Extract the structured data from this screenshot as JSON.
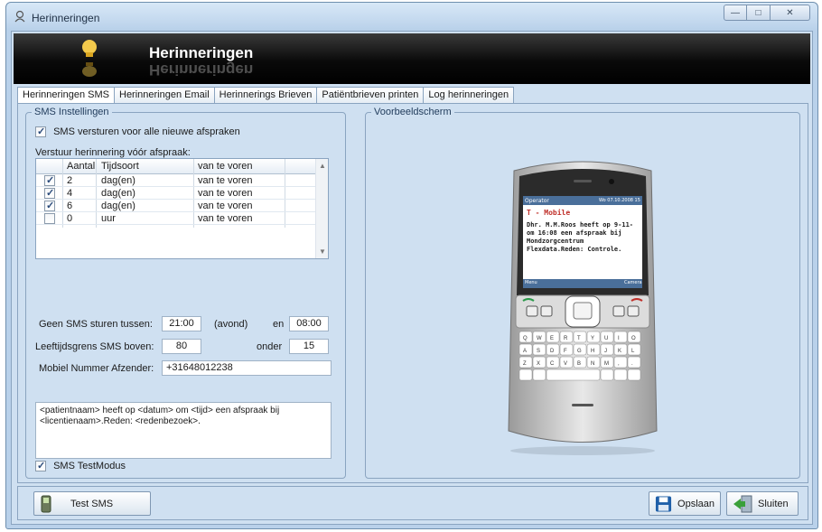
{
  "window": {
    "title": "Herinneringen"
  },
  "banner": {
    "title": "Herinneringen"
  },
  "tabs": [
    {
      "label": "Herinneringen SMS"
    },
    {
      "label": "Herinneringen Email"
    },
    {
      "label": "Herinnerings Brieven"
    },
    {
      "label": "Patiëntbrieven printen"
    },
    {
      "label": "Log herinneringen"
    }
  ],
  "sms_settings": {
    "group_title": "SMS Instellingen",
    "send_all_new": {
      "label": "SMS versturen voor alle nieuwe afspraken",
      "checked": true
    },
    "reminder_heading": "Verstuur herinnering vóór afspraak:",
    "grid": {
      "columns": [
        "Aantal",
        "Tijdsoort",
        "van te voren"
      ],
      "rows": [
        {
          "checked": true,
          "aantal": "2",
          "tijdsoort": "dag(en)",
          "van": "van te voren"
        },
        {
          "checked": true,
          "aantal": "4",
          "tijdsoort": "dag(en)",
          "van": "van te voren"
        },
        {
          "checked": true,
          "aantal": "6",
          "tijdsoort": "dag(en)",
          "van": "van te voren"
        },
        {
          "checked": false,
          "aantal": "0",
          "tijdsoort": "uur",
          "van": "van te voren"
        }
      ]
    },
    "no_sms_label": "Geen SMS sturen tussen:",
    "no_sms_from": "21:00",
    "evening_label": "(avond)",
    "and_label": "en",
    "no_sms_to": "08:00",
    "age_label": "Leeftijdsgrens SMS boven:",
    "age_value": "80",
    "under_label": "onder",
    "under_value": "15",
    "sender_label": "Mobiel Nummer Afzender:",
    "sender_value": "+31648012238",
    "template_text": "<patientnaam> heeft op <datum> om <tijd> een afspraak bij <licentienaam>.Reden: <redenbezoek>.",
    "test_mode": {
      "label": "SMS TestModus",
      "checked": true
    }
  },
  "preview": {
    "group_title": "Voorbeeldscherm",
    "operator": "Operator",
    "status_time": "Wo 07.10.2008 15",
    "carrier": "T - Mobile",
    "message": "Dhr. M.M.Roos heeft op 9-11-om 16:08 een afspraak bij Mondzorgcentrum Flexdata.Reden: Controle.",
    "softkey_left": "Menu",
    "softkey_right": "Camera"
  },
  "buttons": {
    "test_sms": "Test SMS",
    "save": "Opslaan",
    "close": "Sluiten"
  }
}
